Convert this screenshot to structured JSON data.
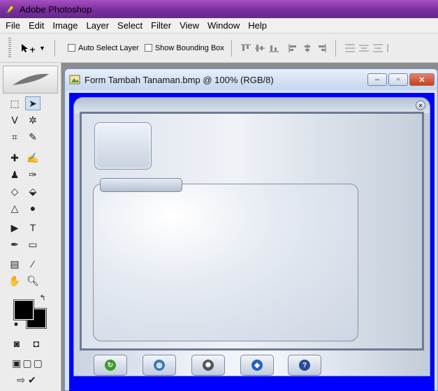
{
  "app": {
    "title": "Adobe Photoshop"
  },
  "menu": [
    "File",
    "Edit",
    "Image",
    "Layer",
    "Select",
    "Filter",
    "View",
    "Window",
    "Help"
  ],
  "options": {
    "auto_select_label": "Auto Select Layer",
    "auto_select_checked": false,
    "bounding_box_label": "Show Bounding Box",
    "bounding_box_checked": false
  },
  "document": {
    "title": "Form Tambah Tanaman.bmp @ 100% (RGB/8)",
    "min_symbol": "–",
    "max_symbol": "▫",
    "close_symbol": "✕"
  },
  "form": {
    "close_symbol": "×",
    "buttons": [
      {
        "icon": "refresh-icon",
        "color": "#3c9a2a"
      },
      {
        "icon": "globe-icon",
        "color": "#3c7ab8"
      },
      {
        "icon": "scan-icon",
        "color": "#555555"
      },
      {
        "icon": "info-icon",
        "color": "#2a5ec0"
      },
      {
        "icon": "help-icon",
        "color": "#2a4aa0"
      }
    ]
  },
  "colors": {
    "foreground": "#000000",
    "background": "#000000",
    "canvas_bg": "#0000ff"
  }
}
